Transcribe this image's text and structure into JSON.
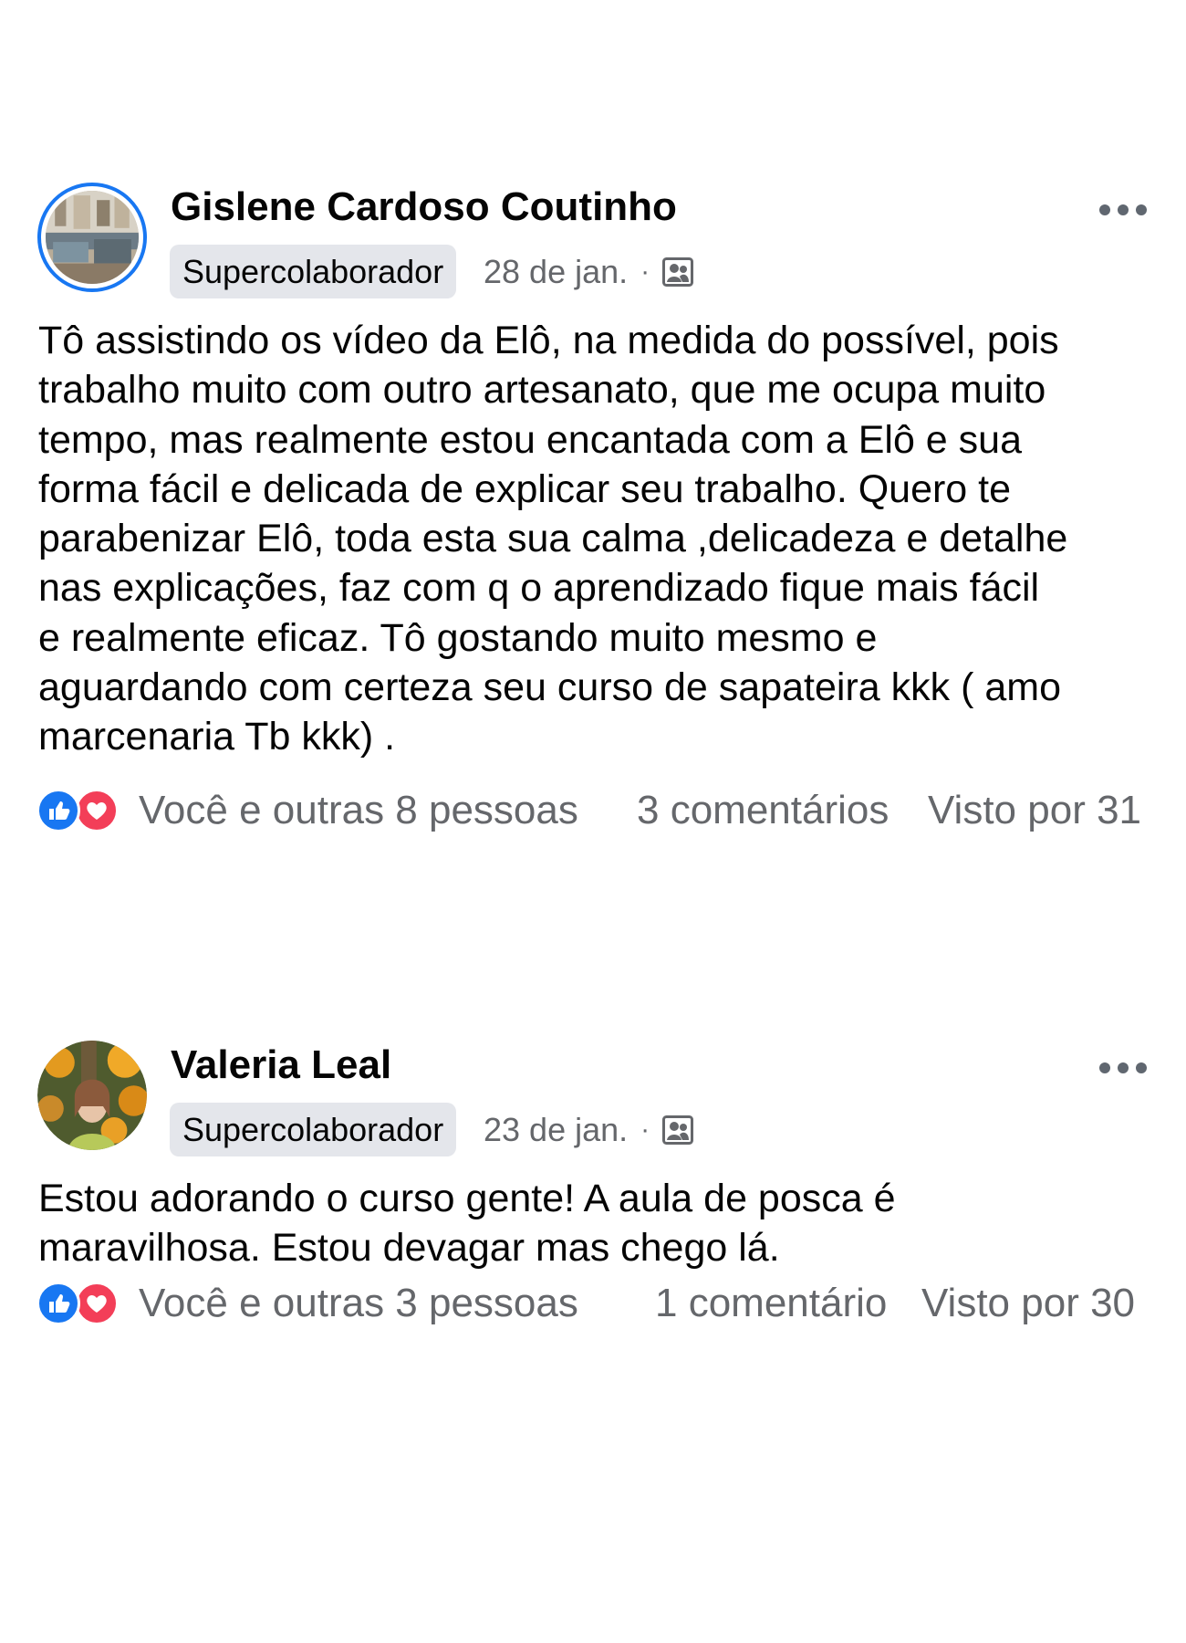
{
  "posts": [
    {
      "author": "Gislene Cardoso Coutinho",
      "badge": "Supercolaborador",
      "date": "28 de jan.",
      "separator": "·",
      "audience_icon": "group-icon",
      "more_icon": "more-options-icon",
      "text": "Tô assistindo os vídeo da Elô, na medida do possível, pois\ntrabalho muito com outro artesanato, que me ocupa muito\ntempo, mas realmente estou encantada com a Elô e sua\nforma fácil e delicada de explicar seu trabalho.  Quero te\nparabenizar Elô, toda esta sua  calma ,delicadeza e detalhe\nnas explicações,  faz com q o aprendizado fique mais fácil\ne realmente eficaz. Tô gostando muito mesmo e\naguardando com certeza seu curso de sapateira kkk ( amo\nmarcenaria Tb kkk) .",
      "reactions_text": "Você e outras 8 pessoas",
      "comments_text": "3 comentários",
      "seen_text": "Visto por 31"
    },
    {
      "author": "Valeria Leal",
      "badge": "Supercolaborador",
      "date": "23 de jan.",
      "separator": "·",
      "audience_icon": "group-icon",
      "more_icon": "more-options-icon",
      "text": "Estou adorando o curso gente! A aula de posca é\nmaravilhosa. Estou devagar mas chego lá.",
      "reactions_text": "Você e outras 3 pessoas",
      "comments_text": "1 comentário",
      "seen_text": "Visto por 30"
    }
  ],
  "colors": {
    "accent": "#1877f2",
    "love": "#f33e58",
    "secondary_text": "#65676b",
    "badge_bg": "#e4e6eb"
  }
}
